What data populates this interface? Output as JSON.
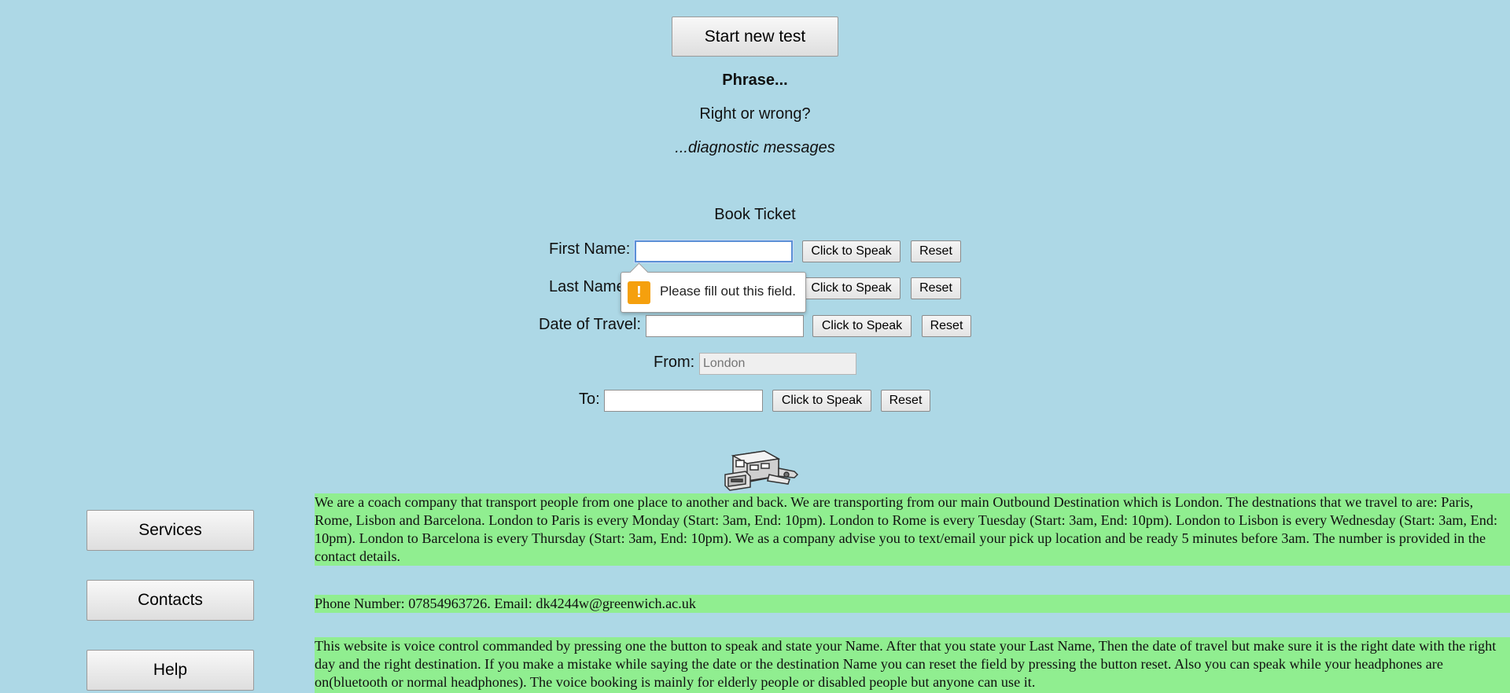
{
  "header": {
    "start_button": "Start new test",
    "phrase": "Phrase...",
    "right_wrong": "Right or wrong?",
    "diagnostic": "...diagnostic messages"
  },
  "form": {
    "title": "Book Ticket",
    "first_name_label": "First Name:",
    "first_name_value": "",
    "last_name_label": "Last Name:",
    "last_name_value": "",
    "date_label": "Date of Travel:",
    "date_value": "",
    "from_label": "From:",
    "from_placeholder": "London",
    "to_label": "To:",
    "to_value": "",
    "speak_label": "Click to Speak",
    "reset_label": "Reset"
  },
  "validation": {
    "message": "Please fill out this field.",
    "icon": "warning-icon",
    "icon_glyph": "!",
    "icon_color": "#f5a00d"
  },
  "sidebar": {
    "services": "Services",
    "contacts": "Contacts",
    "help": "Help"
  },
  "content": {
    "about": "We are a coach company that transport people from one place to another and back. We are transporting from our main Outbound Destination which is London. The destnations that we travel to are: Paris, Rome, Lisbon and Barcelona. London to Paris is every Monday (Start: 3am, End: 10pm). London to Rome is every Tuesday (Start: 3am, End: 10pm). London to Lisbon is every Wednesday (Start: 3am, End: 10pm). London to Barcelona is every Thursday (Start: 3am, End: 10pm). We as a company advise you to text/email your pick up location and be ready 5 minutes before 3am. The number is provided in the contact details.",
    "contact": "Phone Number: 07854963726. Email: dk4244w@greenwich.ac.uk",
    "help": "This website is voice control commanded by pressing one the button to speak and state your Name. After that you state your Last Name, Then the date of travel but make sure it is the right date with the right day and the right destination. If you make a mistake while saying the date or the destination Name you can reset the field by pressing the button reset. Also you can speak while your headphones are on(bluetooth or normal headphones). The voice booking is mainly for elderly people or disabled people but anyone can use it."
  },
  "colors": {
    "background": "#add8e6",
    "highlight": "#90ee90",
    "focus_border": "#5b8fd6"
  }
}
